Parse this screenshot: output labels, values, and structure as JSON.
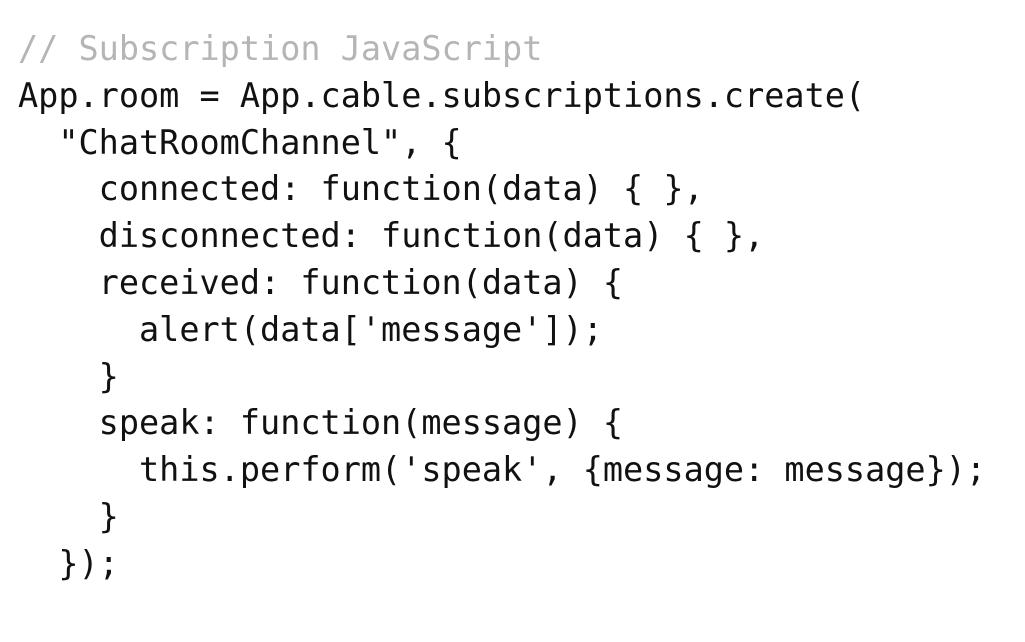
{
  "code": {
    "lines": [
      "// Subscription JavaScript",
      "App.room = App.cable.subscriptions.create(",
      "  \"ChatRoomChannel\", {",
      "    connected: function(data) { },",
      "    disconnected: function(data) { },",
      "    received: function(data) {",
      "      alert(data['message']);",
      "    }",
      "    speak: function(message) {",
      "      this.perform('speak', {message: message});",
      "    }",
      "  });"
    ]
  },
  "colors": {
    "background": "#ffffff",
    "text": "#111111",
    "comment": "#b5b5b5"
  }
}
